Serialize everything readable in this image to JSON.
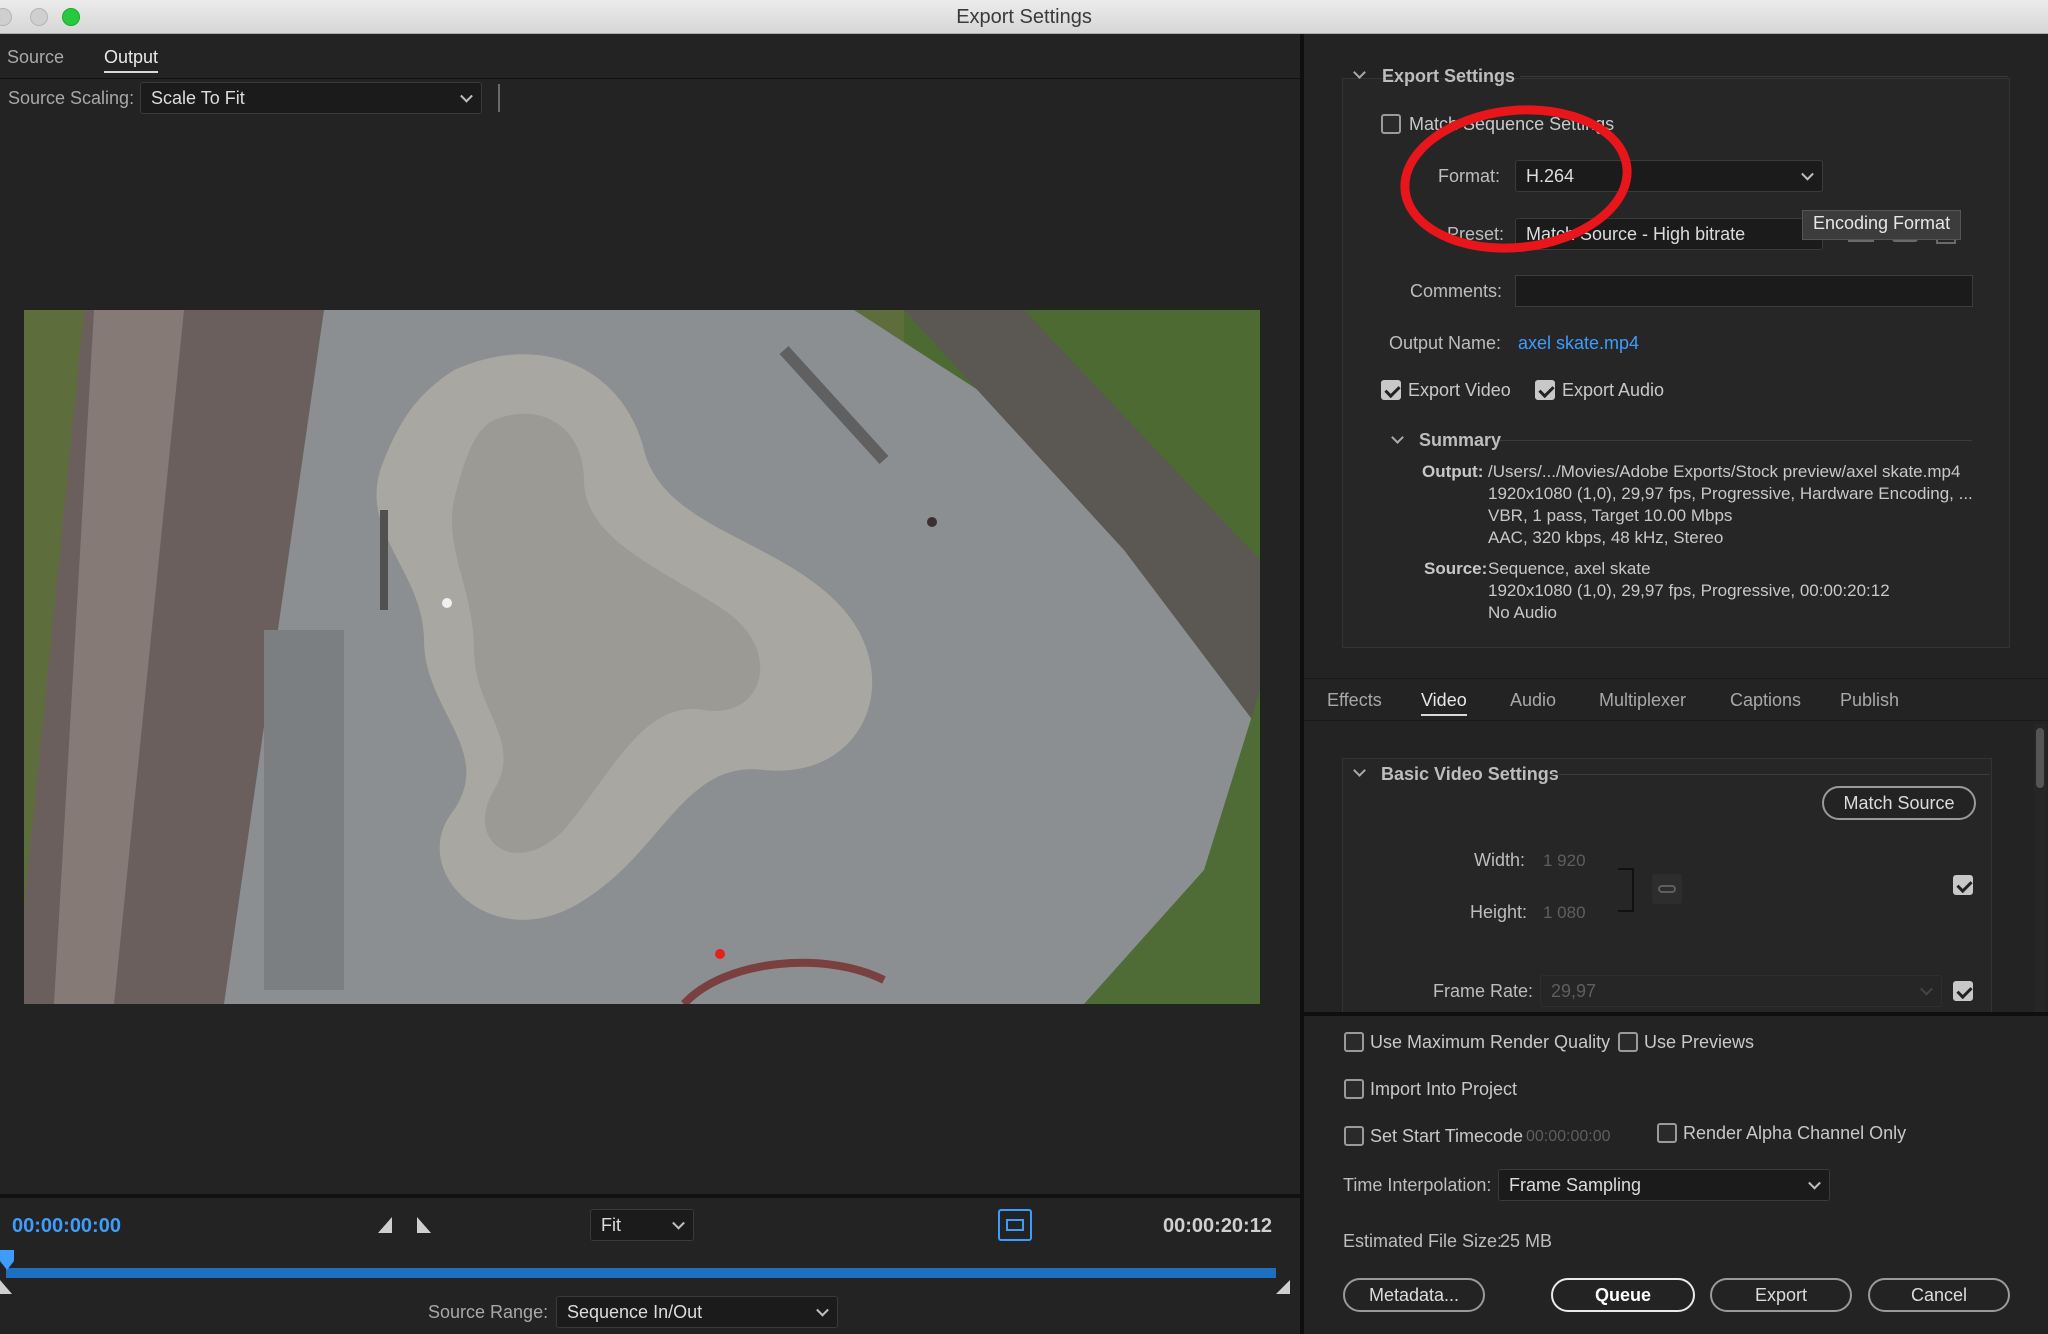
{
  "window": {
    "title": "Export Settings"
  },
  "left": {
    "tabs": [
      "Source",
      "Output"
    ],
    "source_scaling_label": "Source Scaling:",
    "source_scaling_value": "Scale To Fit",
    "timecode_start": "00:00:00:00",
    "timecode_end": "00:00:20:12",
    "zoom_value": "Fit",
    "source_range_label": "Source Range:",
    "source_range_value": "Sequence In/Out",
    "playhead_fraction": 0.0
  },
  "export_settings": {
    "section_title": "Export Settings",
    "match_sequence_label": "Match Sequence Settings",
    "match_sequence_checked": false,
    "format_label": "Format:",
    "format_value": "H.264",
    "preset_label": "Preset:",
    "preset_value": "Match Source - High bitrate",
    "tooltip": "Encoding Format",
    "comments_label": "Comments:",
    "output_name_label": "Output Name:",
    "output_name_value": "axel skate.mp4",
    "export_video_label": "Export Video",
    "export_audio_label": "Export Audio",
    "summary": {
      "title": "Summary",
      "output_label": "Output:",
      "output_lines": [
        "/Users/.../Movies/Adobe Exports/Stock preview/axel skate.mp4",
        "1920x1080 (1,0), 29,97 fps, Progressive, Hardware Encoding, ...",
        "VBR, 1 pass, Target 10.00 Mbps",
        "AAC, 320 kbps, 48 kHz, Stereo"
      ],
      "source_label": "Source:",
      "source_lines": [
        "Sequence, axel skate",
        "1920x1080 (1,0), 29,97 fps, Progressive, 00:00:20:12",
        "No Audio"
      ]
    }
  },
  "settings_tabs": [
    "Effects",
    "Video",
    "Audio",
    "Multiplexer",
    "Captions",
    "Publish"
  ],
  "video": {
    "section_title": "Basic Video Settings",
    "match_source_button": "Match Source",
    "width_label": "Width:",
    "width_value": "1 920",
    "height_label": "Height:",
    "height_value": "1 080",
    "frame_rate_label": "Frame Rate:",
    "frame_rate_value": "29,97"
  },
  "bottom": {
    "max_render_label": "Use Maximum Render Quality",
    "use_previews_label": "Use Previews",
    "import_project_label": "Import Into Project",
    "start_timecode_label": "Set Start Timecode",
    "start_timecode_value": "00:00:00:00",
    "render_alpha_label": "Render Alpha Channel Only",
    "time_interp_label": "Time Interpolation:",
    "time_interp_value": "Frame Sampling",
    "file_size_label": "Estimated File Size:",
    "file_size_value": "25 MB",
    "metadata_button": "Metadata...",
    "queue_button": "Queue",
    "export_button": "Export",
    "cancel_button": "Cancel"
  },
  "colors": {
    "accent": "#3f9cff",
    "annotation": "#e8151b",
    "timeline": "#1e6fc0"
  }
}
